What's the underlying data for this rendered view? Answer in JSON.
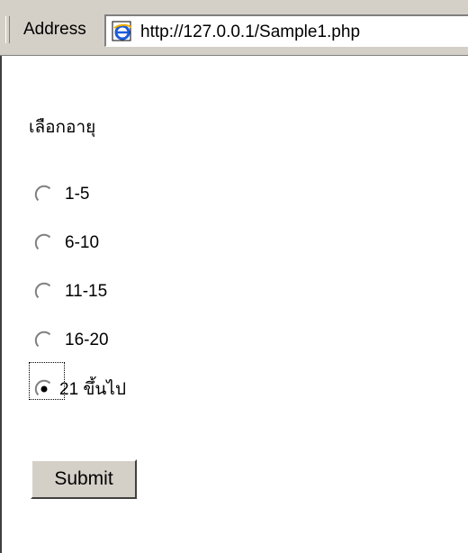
{
  "address_bar": {
    "label": "Address",
    "url": "http://127.0.0.1/Sample1.php",
    "icon": "ie-page-icon"
  },
  "form": {
    "prompt": "เลือกอายุ",
    "options": [
      {
        "label": "1-5",
        "checked": false
      },
      {
        "label": "6-10",
        "checked": false
      },
      {
        "label": "11-15",
        "checked": false
      },
      {
        "label": "16-20",
        "checked": false
      },
      {
        "label": "21 ขึ้นไป",
        "checked": true
      }
    ],
    "submit_label": "Submit"
  }
}
